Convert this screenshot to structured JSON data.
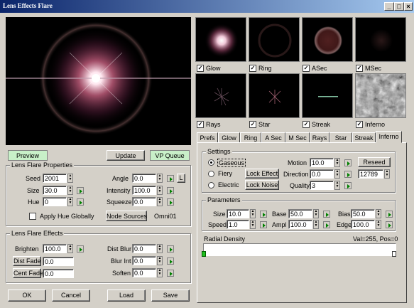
{
  "window": {
    "title": "Lens Effects Flare"
  },
  "preview_buttons": {
    "preview": "Preview",
    "update": "Update",
    "vp_queue": "VP Queue"
  },
  "properties": {
    "title": "Lens Flare Properties",
    "seed_label": "Seed",
    "seed": "2001",
    "size_label": "Size",
    "size": "30.0",
    "hue_label": "Hue",
    "hue": "0",
    "angle_label": "Angle",
    "angle": "0.0",
    "intensity_label": "Intensity",
    "intensity": "100.0",
    "squeeze_label": "Squeeze",
    "squeeze": "0.0",
    "lock_letter": "L",
    "apply_hue_label": "Apply Hue Globally",
    "node_sources_label": "Node Sources",
    "node_source_value": "Omni01"
  },
  "effects": {
    "title": "Lens Flare Effects",
    "brighten_label": "Brighten",
    "brighten": "100.0",
    "dist_fade_label": "Dist Fade",
    "dist_fade": "0.0",
    "cent_fade_label": "Cent Fade",
    "cent_fade": "0.0",
    "dist_blur_label": "Dist Blur",
    "dist_blur": "0.0",
    "blur_int_label": "Blur Int",
    "blur_int": "0.0",
    "soften_label": "Soften",
    "soften": "0.0"
  },
  "bottom_buttons": {
    "ok": "OK",
    "cancel": "Cancel",
    "load": "Load",
    "save": "Save"
  },
  "thumbnails": [
    {
      "label": "Glow",
      "checked": true
    },
    {
      "label": "Ring",
      "checked": true
    },
    {
      "label": "ASec",
      "checked": true
    },
    {
      "label": "MSec",
      "checked": true
    },
    {
      "label": "Rays",
      "checked": true
    },
    {
      "label": "Star",
      "checked": true
    },
    {
      "label": "Streak",
      "checked": true
    },
    {
      "label": "Inferno",
      "checked": true
    }
  ],
  "tabs": [
    "Prefs",
    "Glow",
    "Ring",
    "A Sec",
    "M Sec",
    "Rays",
    "Star",
    "Streak",
    "Inferno"
  ],
  "active_tab": "Inferno",
  "settings": {
    "title": "Settings",
    "gaseous": "Gaseous",
    "fiery": "Fiery",
    "electric": "Electric",
    "lock_effect": "Lock Effect",
    "lock_noise": "Lock Noise",
    "motion_label": "Motion",
    "motion": "10.0",
    "direction_label": "Direction",
    "direction": "0.0",
    "quality_label": "Quality",
    "quality": "3",
    "reseed": "Reseed",
    "seed_value": "12789"
  },
  "parameters": {
    "title": "Parameters",
    "size_label": "Size",
    "size": "10.0",
    "speed_label": "Speed",
    "speed": "1.0",
    "base_label": "Base",
    "base": "50.0",
    "ampl_label": "Ampl",
    "ampl": "100.0",
    "bias_label": "Bias",
    "bias": "50.0",
    "edge_label": "Edge",
    "edge": "100.0"
  },
  "radial": {
    "label": "Radial Density",
    "readout": "Val=255, Pos=0"
  },
  "colors": {
    "green_button": "#c8f0c8",
    "title_start": "#0a246a",
    "title_end": "#a6caf0"
  }
}
